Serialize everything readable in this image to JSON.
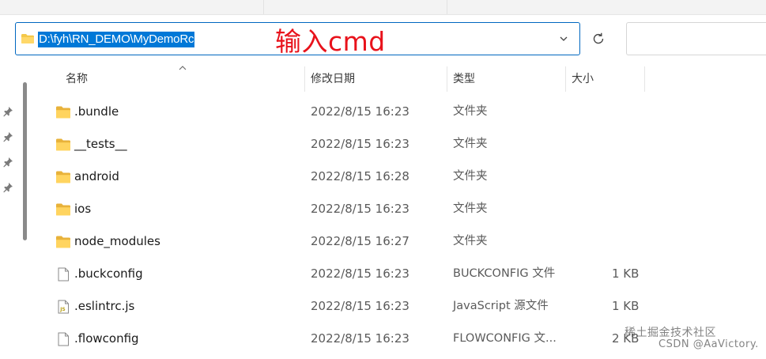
{
  "address": {
    "path": "D:\\fyh\\RN_DEMO\\MyDemoRc"
  },
  "annotation": "输入cmd",
  "columns": {
    "name": "名称",
    "modified": "修改日期",
    "type": "类型",
    "size": "大小"
  },
  "files": [
    {
      "name": ".bundle",
      "modified": "2022/8/15 16:23",
      "type": "文件夹",
      "size": "",
      "icon": "folder-icon"
    },
    {
      "name": "__tests__",
      "modified": "2022/8/15 16:23",
      "type": "文件夹",
      "size": "",
      "icon": "folder-icon"
    },
    {
      "name": "android",
      "modified": "2022/8/15 16:28",
      "type": "文件夹",
      "size": "",
      "icon": "folder-icon"
    },
    {
      "name": "ios",
      "modified": "2022/8/15 16:23",
      "type": "文件夹",
      "size": "",
      "icon": "folder-icon"
    },
    {
      "name": "node_modules",
      "modified": "2022/8/15 16:27",
      "type": "文件夹",
      "size": "",
      "icon": "folder-icon"
    },
    {
      "name": ".buckconfig",
      "modified": "2022/8/15 16:23",
      "type": "BUCKCONFIG 文件",
      "size": "1 KB",
      "icon": "file-icon"
    },
    {
      "name": ".eslintrc.js",
      "modified": "2022/8/15 16:23",
      "type": "JavaScript 源文件",
      "size": "1 KB",
      "icon": "js-file-icon"
    },
    {
      "name": ".flowconfig",
      "modified": "2022/8/15 16:23",
      "type": "FLOWCONFIG 文...",
      "size": "2 KB",
      "icon": "file-icon"
    }
  ],
  "watermark": {
    "line1": "稀土掘金技术社区",
    "line2": "CSDN @AaVictory."
  },
  "colors": {
    "accent": "#0078d7",
    "annotation": "#e8121b",
    "folder": "#f4c84a"
  }
}
